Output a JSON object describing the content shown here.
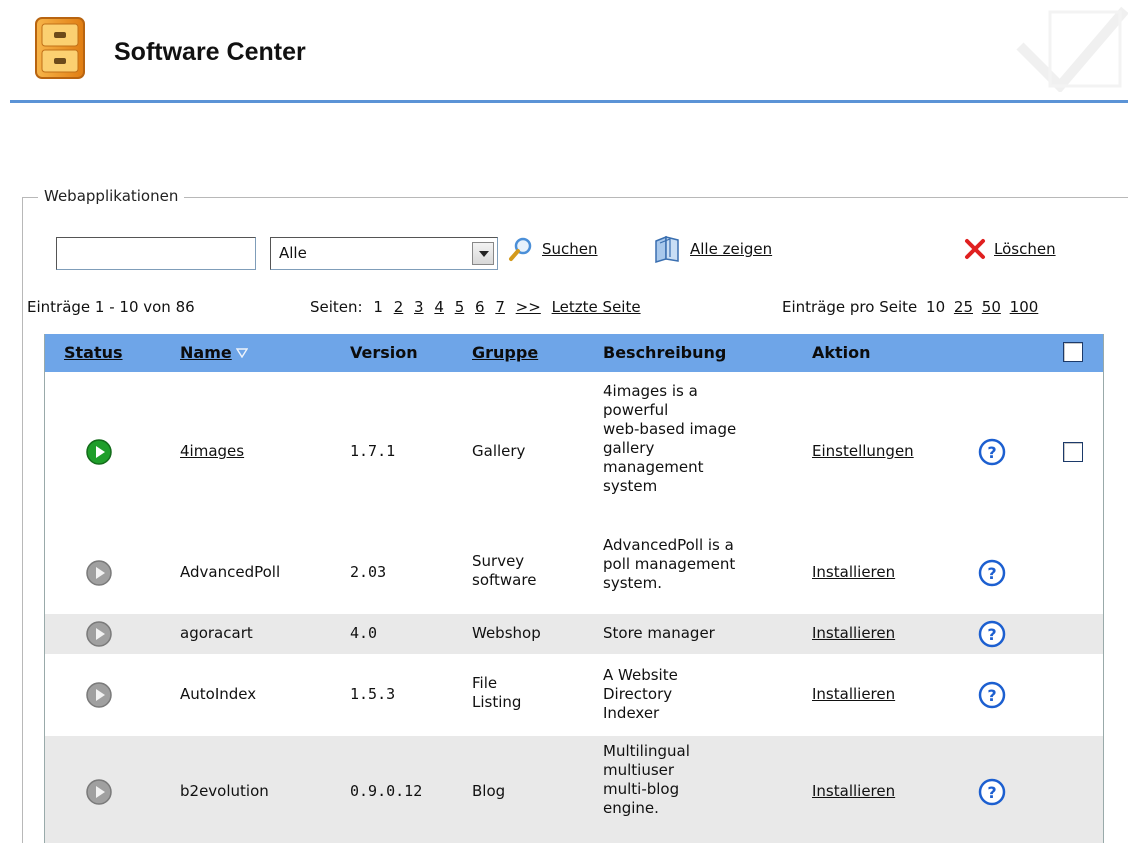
{
  "header": {
    "title": "Software Center"
  },
  "section": {
    "legend": "Webapplikationen",
    "search_value": "",
    "filter_selected": "Alle",
    "search_label": "Suchen",
    "show_all_label": "Alle zeigen",
    "delete_label": "Löschen"
  },
  "pagination": {
    "entries_text": "Einträge 1 - 10 von 86",
    "pages_label": "Seiten:",
    "pages": [
      "1",
      "2",
      "3",
      "4",
      "5",
      "6",
      "7",
      ">>"
    ],
    "last_page_label": "Letzte Seite",
    "per_page_label": "Einträge pro Seite",
    "per_page_options": [
      "10",
      "25",
      "50",
      "100"
    ]
  },
  "table": {
    "headers": {
      "status": "Status",
      "name": "Name",
      "version": "Version",
      "group": "Gruppe",
      "description": "Beschreibung",
      "action": "Aktion"
    },
    "rows": [
      {
        "status": "active",
        "name": "4images",
        "version": "1.7.1",
        "group": [
          "Gallery"
        ],
        "description": [
          "4images is a",
          "powerful",
          "web-based image",
          "gallery",
          "management",
          "system"
        ],
        "action": "Einstellungen"
      },
      {
        "status": "inactive",
        "name": "AdvancedPoll",
        "version": "2.03",
        "group": [
          "Survey",
          "software"
        ],
        "description": [
          "AdvancedPoll is a",
          "poll management",
          "system."
        ],
        "action": "Installieren"
      },
      {
        "status": "inactive",
        "name": "agoracart",
        "version": "4.0",
        "group": [
          "Webshop"
        ],
        "description": [
          "Store manager"
        ],
        "action": "Installieren"
      },
      {
        "status": "inactive",
        "name": "AutoIndex",
        "version": "1.5.3",
        "group": [
          "File",
          "Listing"
        ],
        "description": [
          "A Website",
          "Directory",
          "Indexer"
        ],
        "action": "Installieren"
      },
      {
        "status": "inactive",
        "name": "b2evolution",
        "version": "0.9.0.12",
        "group": [
          "Blog"
        ],
        "description": [
          "Multilingual",
          "multiuser",
          "multi-blog",
          "engine."
        ],
        "action": "Installieren"
      }
    ]
  },
  "colors": {
    "accent_rule": "#5b93d6",
    "table_header": "#6ea5e8",
    "status_active": "#1f9e2a",
    "status_inactive": "#9a9a9a",
    "help_icon": "#1c5fd0"
  },
  "icons": [
    "file-cabinet-icon",
    "magnifier-icon",
    "book-icon",
    "red-x-icon",
    "play-icon",
    "help-icon"
  ]
}
